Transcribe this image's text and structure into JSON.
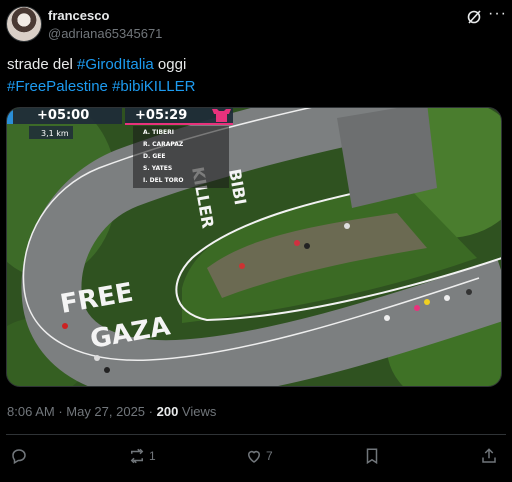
{
  "author": {
    "display_name": "francesco",
    "handle": "@adriana65345671"
  },
  "tweet": {
    "text_line1_prefix": "strade del ",
    "hashtag1": "#GirodItalia",
    "text_line1_suffix": " oggi",
    "hashtag2": "#FreePalestine",
    "hashtag3": "#bibiKILLER"
  },
  "media": {
    "time_gap_1": "+05:00",
    "time_gap_2": "+05:29",
    "distance": "3,1 km",
    "riders": [
      "A. TIBERI",
      "R. CARAPAZ",
      "D. GEE",
      "S. YATES",
      "I. DEL TORO"
    ],
    "painted_text_1": "FREE",
    "painted_text_2": "GAZA",
    "painted_text_3": "BIBI",
    "painted_text_4": "KILLER",
    "jersey_color": "#e8327c"
  },
  "meta": {
    "time": "8:06 AM",
    "separator1": " · ",
    "date": "May 27, 2025",
    "separator2": " · ",
    "views_count": "200",
    "views_label": " Views"
  },
  "actions": {
    "reposts": "1",
    "likes": "7"
  },
  "icons": [
    "grok-icon",
    "more-icon",
    "reply-icon",
    "repost-icon",
    "like-icon",
    "bookmark-icon",
    "share-icon"
  ],
  "colors": {
    "accent": "#1d9bf0",
    "muted": "#71767b",
    "text": "#e7e9ea",
    "background": "#000000"
  }
}
